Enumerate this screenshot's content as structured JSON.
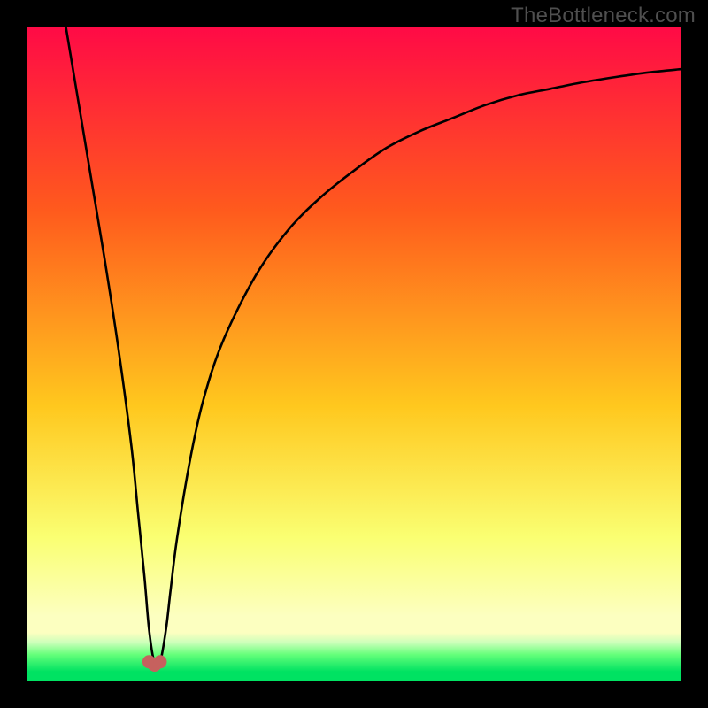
{
  "watermark": "TheBottleneck.com",
  "colors": {
    "frame": "#000000",
    "grad_top": "#ff0a46",
    "grad_upper_mid": "#ff5a1d",
    "grad_mid": "#ffc81e",
    "grad_lower_mid": "#faff72",
    "grad_pale_yellow": "#fcffc0",
    "grad_pale_green": "#ccffba",
    "grad_green_mid": "#64ff7a",
    "grad_green": "#00e262",
    "curve_stroke": "#000000",
    "marker_fill": "#c6615e",
    "marker_stroke": "#c6615e",
    "watermark": "#4f4f4f"
  },
  "chart_data": {
    "type": "line",
    "title": "",
    "xlabel": "",
    "ylabel": "",
    "xlim": [
      0,
      100
    ],
    "ylim": [
      0,
      100
    ],
    "series": [
      {
        "name": "bottleneck-curve",
        "x": [
          6,
          8,
          10,
          12,
          14,
          16,
          17,
          18,
          18.7,
          19.5,
          20.4,
          21.3,
          22,
          23,
          25,
          27,
          30,
          35,
          40,
          45,
          50,
          55,
          60,
          65,
          70,
          75,
          80,
          85,
          90,
          95,
          100
        ],
        "y": [
          100,
          88,
          76,
          64,
          51,
          36,
          26,
          16,
          8,
          3,
          3,
          8,
          14,
          22,
          34,
          43,
          52,
          62,
          69,
          74,
          78,
          81.5,
          84,
          86,
          88,
          89.5,
          90.5,
          91.5,
          92.3,
          93,
          93.5
        ]
      }
    ],
    "markers": [
      {
        "x": 18.7,
        "y": 3.0
      },
      {
        "x": 20.4,
        "y": 3.0
      }
    ],
    "marker_link": {
      "from": 0,
      "to": 1,
      "dip": 1.8
    }
  }
}
